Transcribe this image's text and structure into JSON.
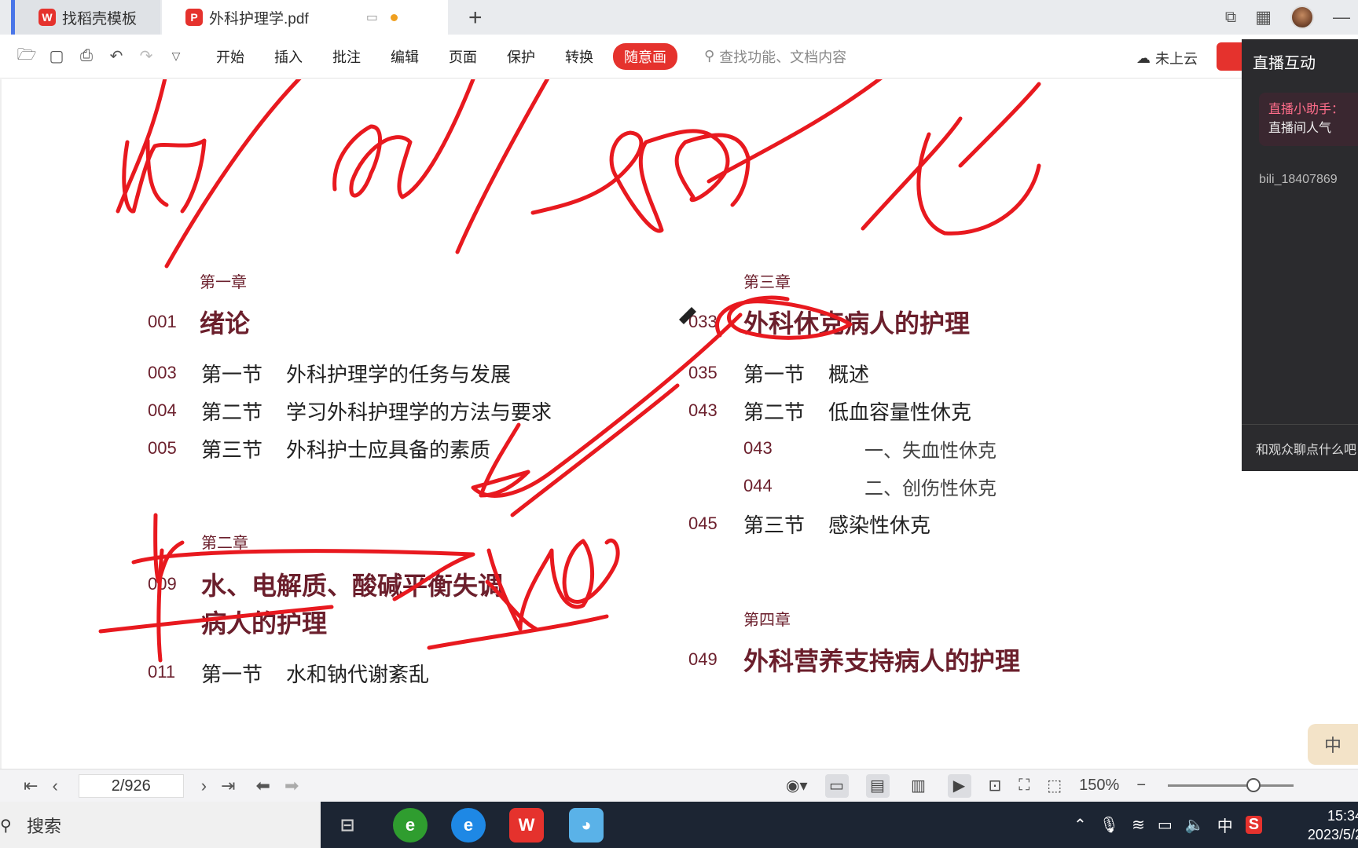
{
  "tabs": [
    {
      "label": "找稻壳模板"
    },
    {
      "label": "外科护理学.pdf"
    }
  ],
  "toolbar": {
    "menu": [
      "开始",
      "插入",
      "批注",
      "编辑",
      "页面",
      "保护",
      "转换",
      "随意画"
    ],
    "search_placeholder": "查找功能、文档内容",
    "cloud_status": "未上云"
  },
  "live_panel": {
    "title": "直播互动",
    "assistant_name": "直播小助手：",
    "assistant_msg": "直播间人气",
    "user": "bili_18407869",
    "input_placeholder": "和观众聊点什么吧"
  },
  "document": {
    "chapter1": {
      "label": "第一章",
      "page": "001",
      "title": "绪论",
      "sections": [
        {
          "page": "003",
          "label": "第一节",
          "title": "外科护理学的任务与发展"
        },
        {
          "page": "004",
          "label": "第二节",
          "title": "学习外科护理学的方法与要求"
        },
        {
          "page": "005",
          "label": "第三节",
          "title": "外科护士应具备的素质"
        }
      ]
    },
    "chapter2": {
      "label": "第二章",
      "page": "009",
      "title_line1": "水、电解质、酸碱平衡失调",
      "title_line2": "病人的护理",
      "sections": [
        {
          "page": "011",
          "label": "第一节",
          "title": "水和钠代谢紊乱"
        }
      ]
    },
    "chapter3": {
      "label": "第三章",
      "page": "033",
      "title": "外科休克病人的护理",
      "sections": [
        {
          "page": "035",
          "label": "第一节",
          "title": "概述"
        },
        {
          "page": "043",
          "label": "第二节",
          "title": "低血容量性休克"
        }
      ],
      "subsections": [
        {
          "page": "043",
          "title": "一、失血性休克"
        },
        {
          "page": "044",
          "title": "二、创伤性休克"
        }
      ],
      "section3": {
        "page": "045",
        "label": "第三节",
        "title": "感染性休克"
      }
    },
    "chapter4": {
      "label": "第四章",
      "page": "049",
      "title": "外科营养支持病人的护理"
    }
  },
  "side_tab": "中",
  "statusbar": {
    "page_indicator": "2/926",
    "zoom": "150%"
  },
  "taskbar": {
    "search_label": "搜索",
    "ime": "中",
    "time": "15:34",
    "date": "2023/5/2"
  }
}
